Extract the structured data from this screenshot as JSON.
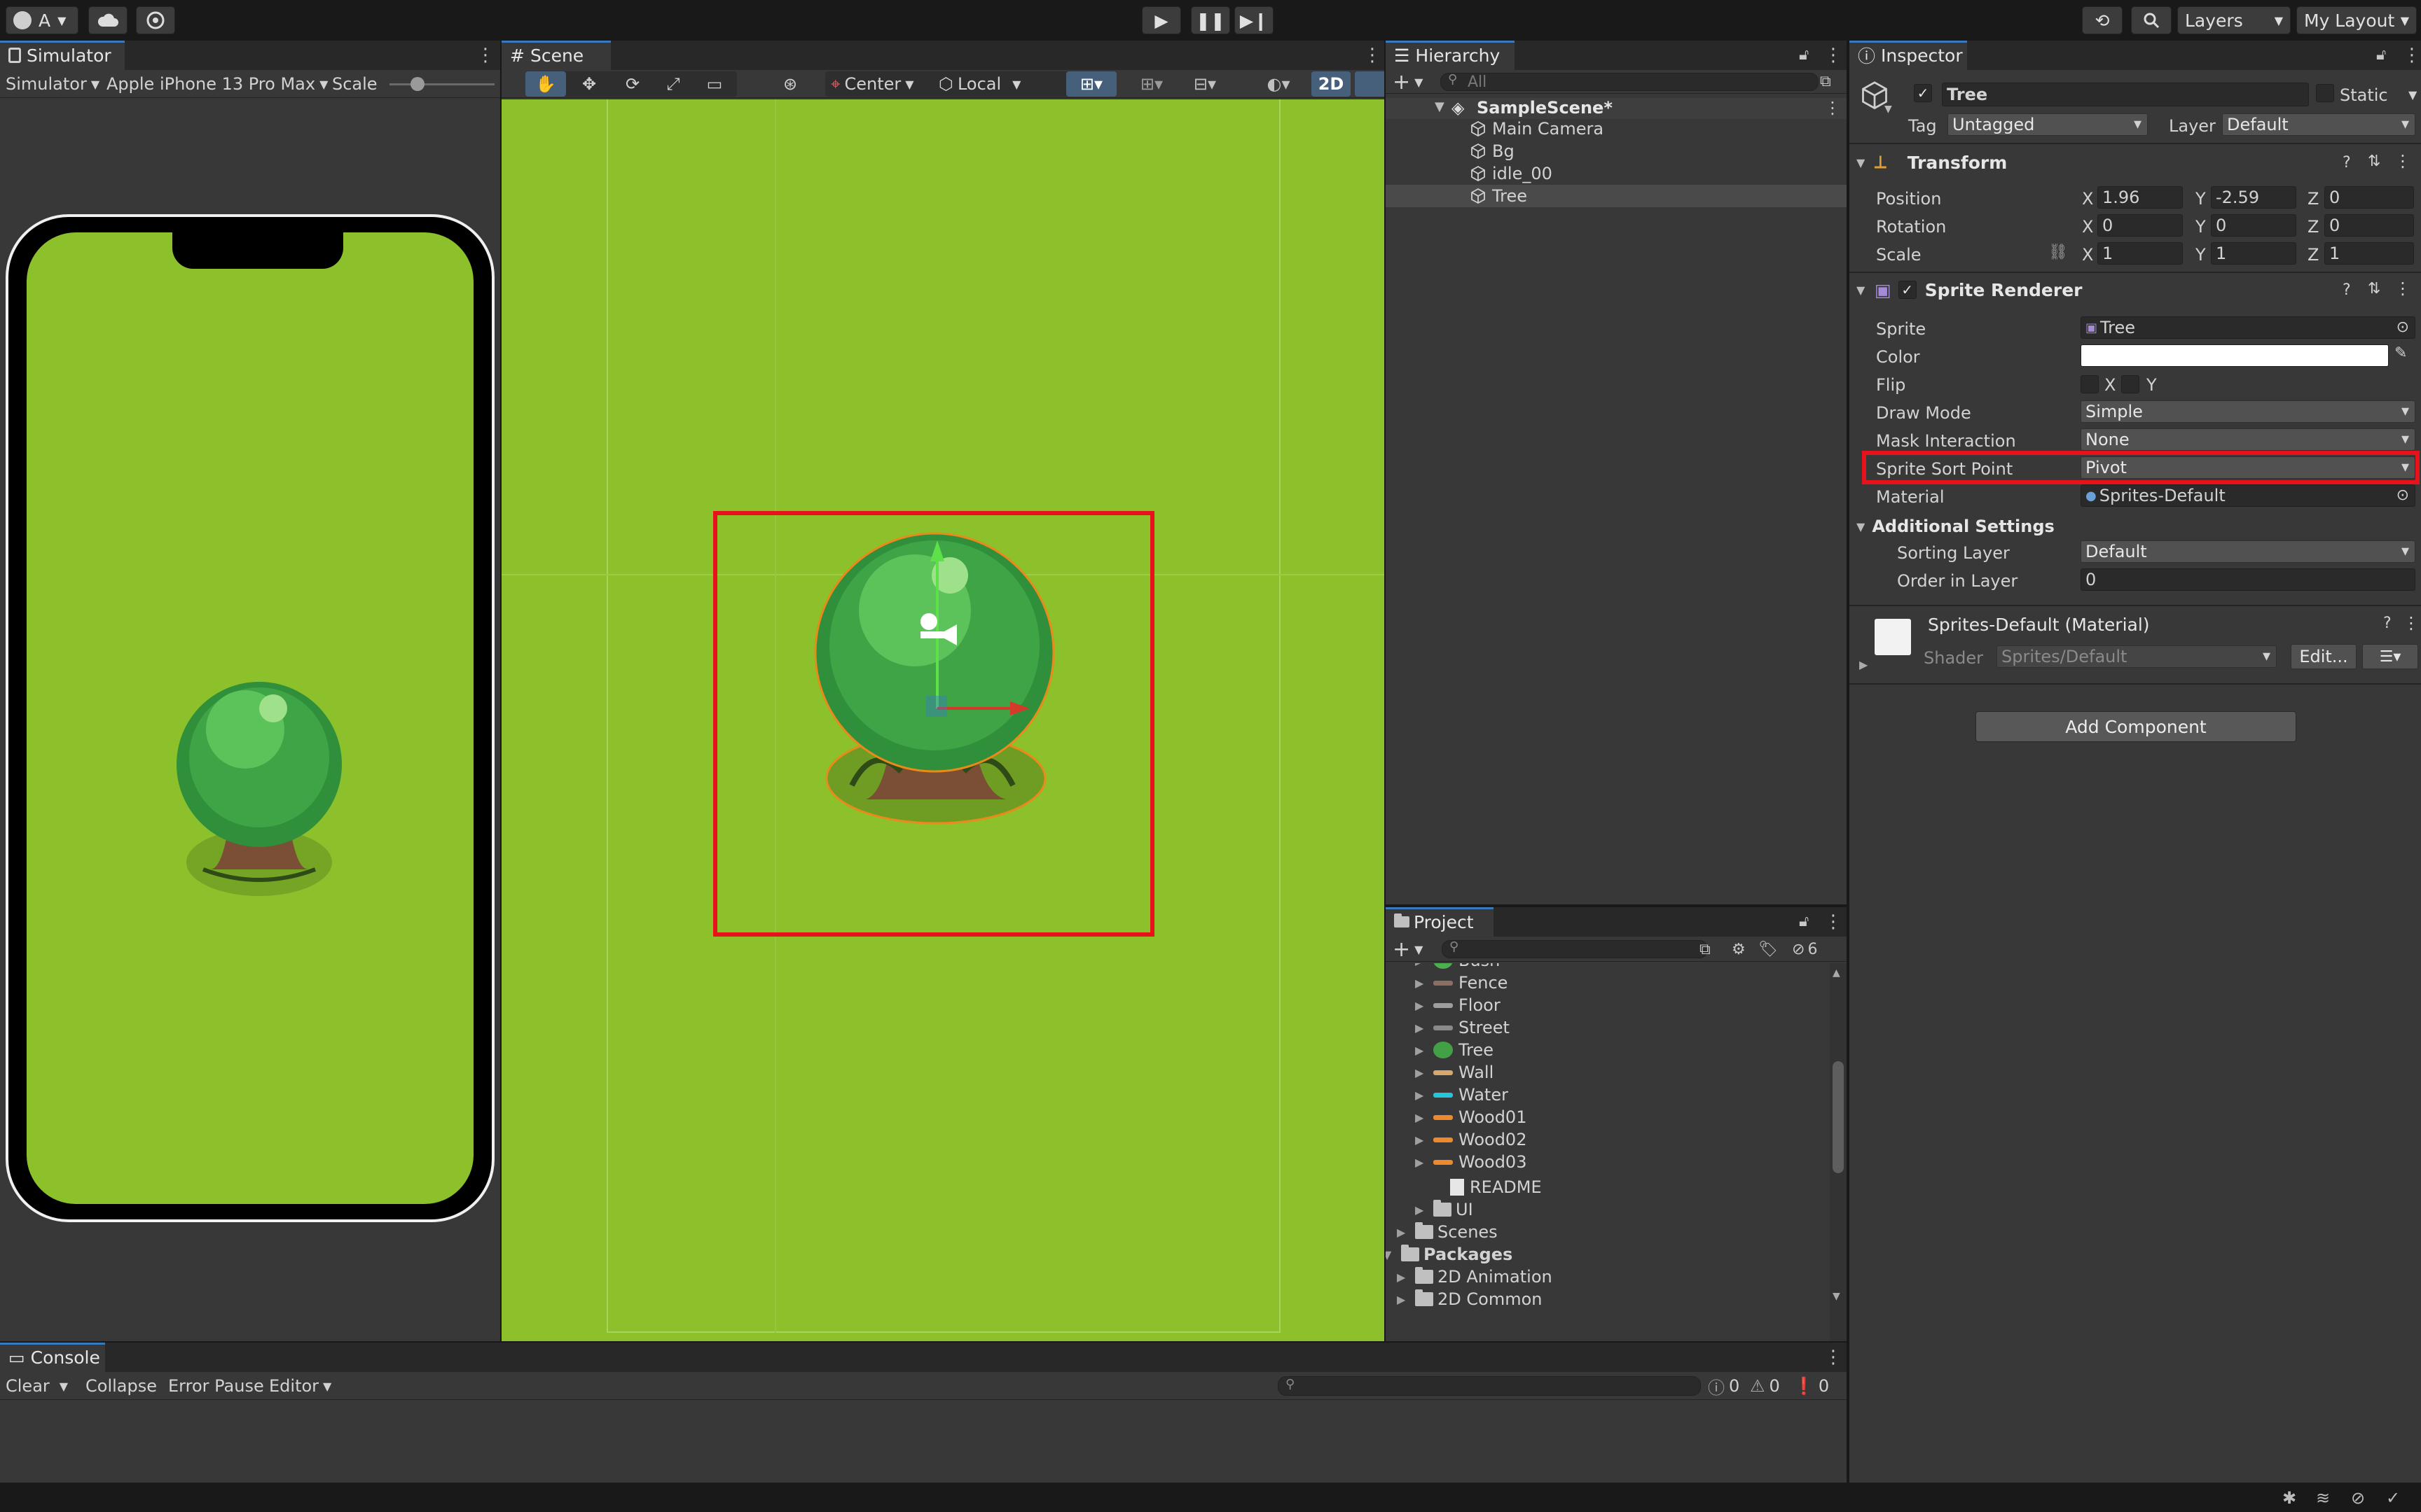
{
  "toolbar": {
    "account_label": "A",
    "layers_label": "Layers",
    "layout_label": "My Layout"
  },
  "simulator": {
    "tab_label": "Simulator",
    "mode_label": "Simulator",
    "device_label": "Apple iPhone 13 Pro Max",
    "scale_label": "Scale"
  },
  "scene": {
    "tab_label": "Scene",
    "pivot_label": "Center",
    "space_label": "Local",
    "mode_2d_label": "2D"
  },
  "hierarchy": {
    "tab_label": "Hierarchy",
    "search_placeholder": "All",
    "scene_name": "SampleScene*",
    "items": [
      "Main Camera",
      "Bg",
      "idle_00",
      "Tree"
    ]
  },
  "project": {
    "tab_label": "Project",
    "hidden_count": "6",
    "assets": [
      {
        "label": "Bush",
        "icon": "bush",
        "color": "#4caf50"
      },
      {
        "label": "Fence",
        "icon": "fence",
        "color": "#8d6e63"
      },
      {
        "label": "Floor",
        "icon": "floor",
        "color": "#9e9e9e"
      },
      {
        "label": "Street",
        "icon": "street",
        "color": "#8a8a8a"
      },
      {
        "label": "Tree",
        "icon": "tree",
        "color": "#43a047"
      },
      {
        "label": "Wall",
        "icon": "wall",
        "color": "#d7a86e"
      },
      {
        "label": "Water",
        "icon": "water",
        "color": "#26c6da"
      },
      {
        "label": "Wood01",
        "icon": "wood",
        "color": "#ef8a2c"
      },
      {
        "label": "Wood02",
        "icon": "wood",
        "color": "#ef8a2c"
      },
      {
        "label": "Wood03",
        "icon": "wood",
        "color": "#ef8a2c"
      }
    ],
    "readme_label": "README",
    "ui_label": "UI",
    "scenes_label": "Scenes",
    "packages_label": "Packages",
    "pkg_items": [
      "2D Animation",
      "2D Common"
    ]
  },
  "inspector": {
    "tab_label": "Inspector",
    "object_name": "Tree",
    "static_label": "Static",
    "tag_label": "Tag",
    "tag_value": "Untagged",
    "layer_label": "Layer",
    "layer_value": "Default",
    "transform": {
      "title": "Transform",
      "position_label": "Position",
      "rotation_label": "Rotation",
      "scale_label": "Scale",
      "position": {
        "x": "1.96",
        "y": "-2.59",
        "z": "0"
      },
      "rotation": {
        "x": "0",
        "y": "0",
        "z": "0"
      },
      "scale": {
        "x": "1",
        "y": "1",
        "z": "1"
      }
    },
    "sprite_renderer": {
      "title": "Sprite Renderer",
      "sprite_label": "Sprite",
      "sprite_value": "Tree",
      "color_label": "Color",
      "color_value": "#ffffff",
      "flip_label": "Flip",
      "flip_x": "X",
      "flip_y": "Y",
      "draw_mode_label": "Draw Mode",
      "draw_mode_value": "Simple",
      "mask_label": "Mask Interaction",
      "mask_value": "None",
      "sort_point_label": "Sprite Sort Point",
      "sort_point_value": "Pivot",
      "material_label": "Material",
      "material_value": "Sprites-Default",
      "additional_label": "Additional Settings",
      "sorting_layer_label": "Sorting Layer",
      "sorting_layer_value": "Default",
      "order_label": "Order in Layer",
      "order_value": "0"
    },
    "material": {
      "title": "Sprites-Default (Material)",
      "shader_label": "Shader",
      "shader_value": "Sprites/Default",
      "edit_label": "Edit..."
    },
    "add_component_label": "Add Component"
  },
  "console": {
    "tab_label": "Console",
    "clear_label": "Clear",
    "collapse_label": "Collapse",
    "error_pause_label": "Error Pause",
    "editor_label": "Editor",
    "log_count": "0",
    "warn_count": "0",
    "error_count": "0"
  },
  "colors": {
    "highlight": "#e8121a",
    "grass": "#8cc12b",
    "accent": "#3a79bb"
  }
}
